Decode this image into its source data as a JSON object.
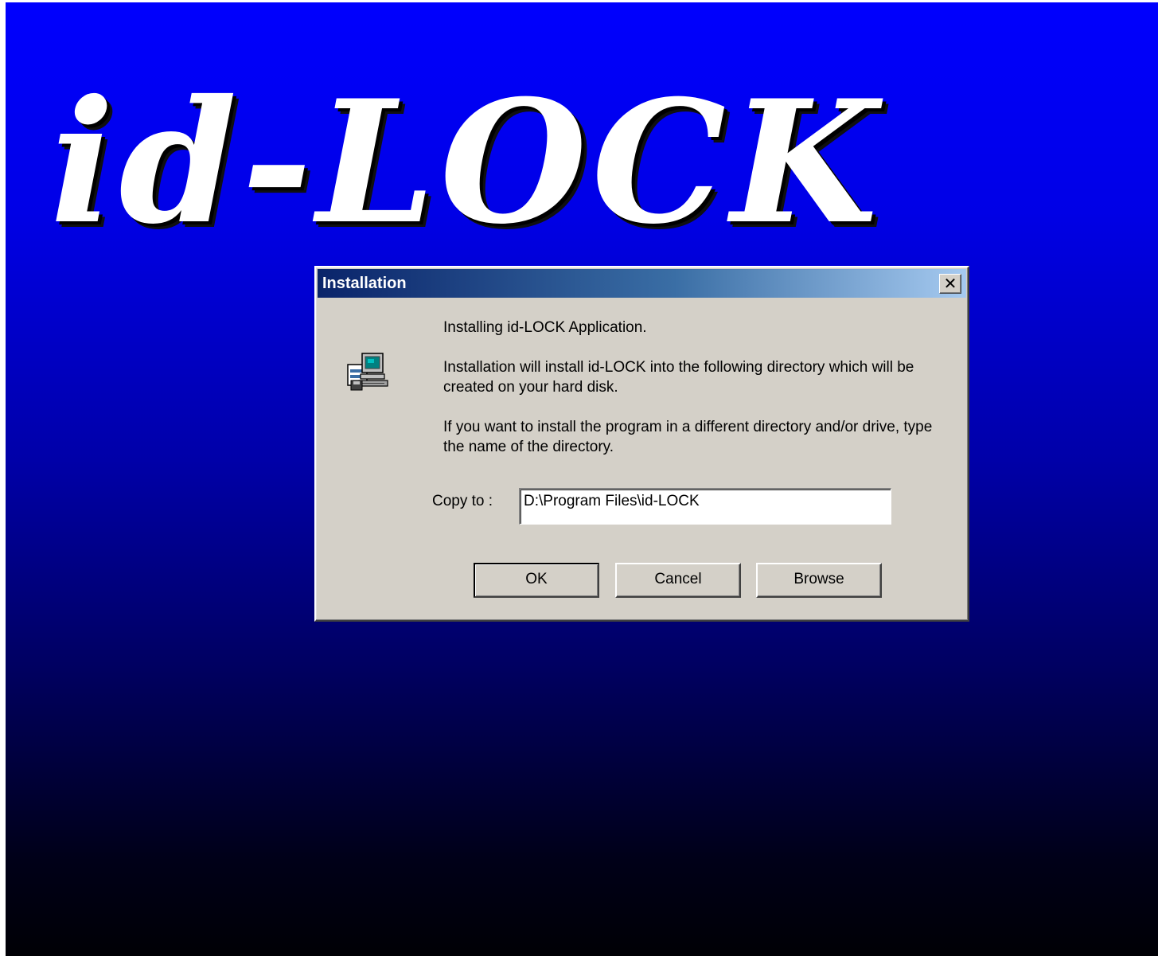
{
  "background": {
    "logo_text": "id-LOCK",
    "gradient_top": "#0000fe",
    "gradient_bottom": "#000005"
  },
  "dialog": {
    "title": "Installation",
    "close_label": "✕",
    "icon": "setup-computer-icon",
    "messages": [
      "Installing id-LOCK Application.",
      "Installation will install id-LOCK into the following directory which will be created on your hard disk.",
      "If you want to install the program in a different directory and/or drive, type the name of the directory."
    ],
    "copy_to_label": "Copy to :",
    "copy_to_value": "D:\\Program Files\\id-LOCK",
    "buttons": {
      "ok": "OK",
      "cancel": "Cancel",
      "browse": "Browse"
    },
    "title_gradient_start": "#0a246a",
    "title_gradient_end": "#a6caf0",
    "face_color": "#d4d0c8"
  }
}
